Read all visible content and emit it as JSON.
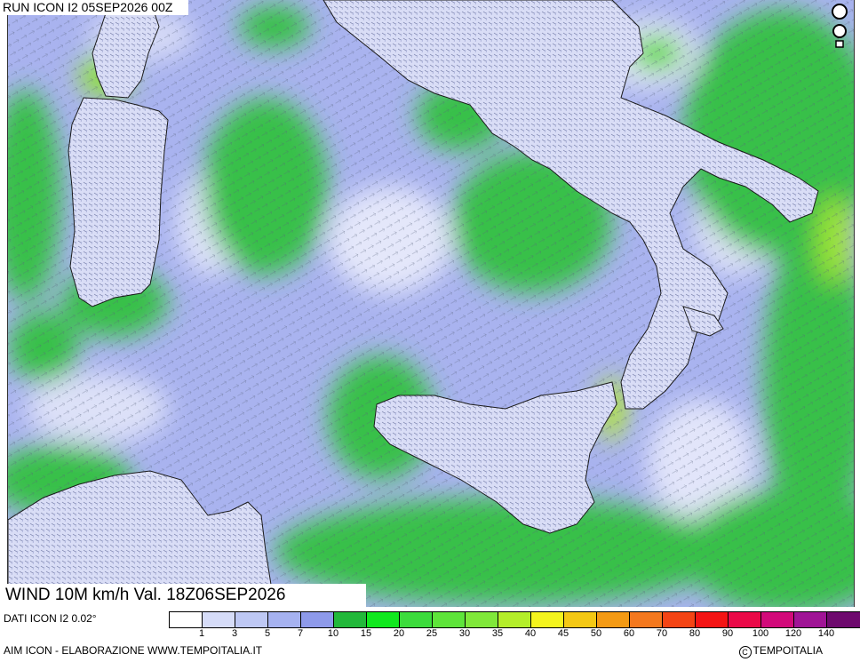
{
  "header": {
    "run_label": "RUN ICON I2 05SEP2026 00Z"
  },
  "footer": {
    "title": "WIND 10M km/h Val. 18Z06SEP2026",
    "data_source": "DATI ICON I2 0.02°",
    "credit": "AIM ICON - ELABORAZIONE WWW.TEMPOITALIA.IT",
    "copyright": "TEMPOITALIA"
  },
  "legend": {
    "colors": [
      "#ffffff",
      "#d6dcf8",
      "#bec8f4",
      "#a6b2f0",
      "#8e9aea",
      "#22b83a",
      "#10e81e",
      "#3cdc3c",
      "#5ee43a",
      "#80e83a",
      "#b4ee2a",
      "#f4f41e",
      "#f4c814",
      "#f49a14",
      "#f4781e",
      "#f44414",
      "#f41414",
      "#ea0a48",
      "#d20a7a",
      "#a01496",
      "#6e0a6e"
    ],
    "ticks": [
      "1",
      "3",
      "5",
      "7",
      "10",
      "15",
      "20",
      "25",
      "30",
      "35",
      "40",
      "45",
      "50",
      "60",
      "70",
      "80",
      "90",
      "100",
      "120",
      "140"
    ]
  },
  "map": {
    "land_color": "#d8ddf5",
    "sea_colors": {
      "calm": "#d9ddf7",
      "light": "#a9b3ef",
      "moderate": "#37c04a",
      "strong": "#8fe03a"
    }
  }
}
